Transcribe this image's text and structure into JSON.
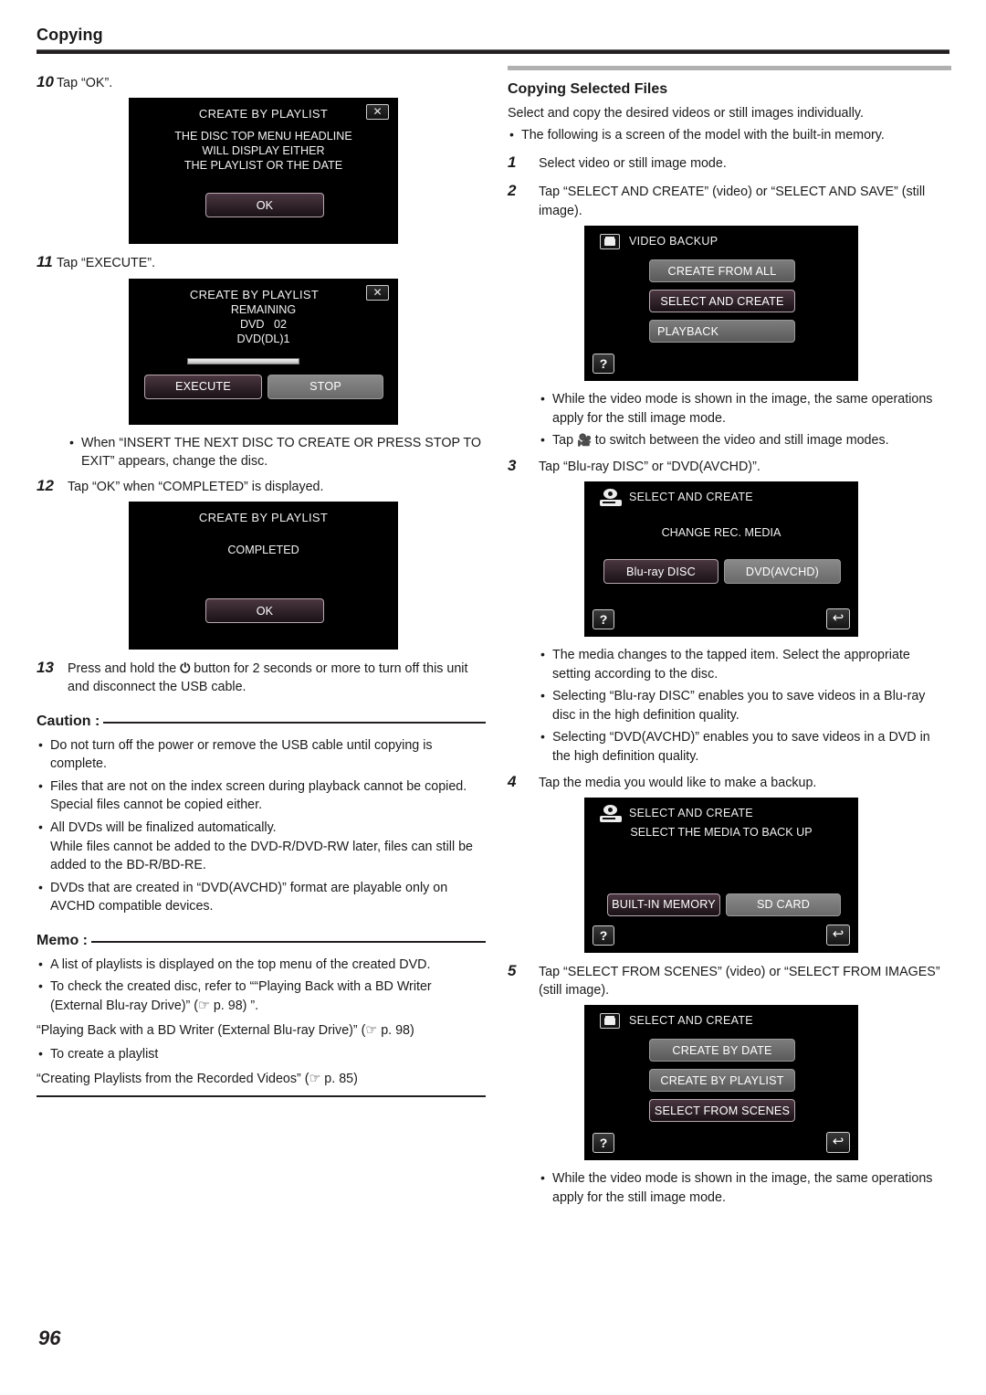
{
  "header": {
    "title": "Copying"
  },
  "page_number": "96",
  "left_column": {
    "step10": {
      "num": "10",
      "text": "Tap “OK”."
    },
    "shot_playlist_notice": {
      "name": "create-by-playlist-notice",
      "title": "CREATE BY PLAYLIST",
      "close_label": "✕",
      "message_lines": [
        "THE DISC TOP MENU HEADLINE",
        "WILL DISPLAY EITHER",
        "THE PLAYLIST OR THE DATE"
      ],
      "ok_label": "OK"
    },
    "step11": {
      "num": "11",
      "text": "Tap “EXECUTE”."
    },
    "shot_remaining": {
      "name": "create-by-playlist-remaining",
      "title": "CREATE BY PLAYLIST",
      "close_label": "✕",
      "message_lines": [
        "REMAINING",
        "DVD   02",
        "DVD(DL)1"
      ],
      "execute_label": "EXECUTE",
      "stop_label": "STOP"
    },
    "note_insert_disc": "When “INSERT THE NEXT DISC TO CREATE OR PRESS STOP TO EXIT” appears, change the disc.",
    "step12": {
      "num": "12",
      "text": "Tap “OK” when “COMPLETED” is displayed."
    },
    "shot_completed": {
      "name": "create-by-playlist-completed",
      "title": "CREATE BY PLAYLIST",
      "message_lines": [
        "COMPLETED"
      ],
      "ok_label": "OK"
    },
    "step13": {
      "num": "13",
      "text_before": "Press and hold the",
      "power_glyph": "⏻",
      "text_after": "button for 2 seconds or more to turn off this unit and disconnect the USB cable."
    },
    "caution": {
      "label": "Caution :",
      "items": [
        "Do not turn off the power or remove the USB cable until copying is complete.",
        "Files that are not on the index screen during playback cannot be copied. Special files cannot be copied either.",
        "All DVDs will be finalized automatically.\nWhile files cannot be added to the DVD-R/DVD-RW later, files can still be added to the BD-R/BD-RE.",
        "DVDs that are created in “DVD(AVCHD)” format are playable only on AVCHD compatible devices."
      ]
    },
    "memo": {
      "label": "Memo :",
      "items": [
        "A list of playlists is displayed on the top menu of the created DVD.",
        "To check the created disc, refer to ““Playing Back with a BD Writer (External Blu-ray Drive)” (☞ p. 98) ”."
      ],
      "ref1": "“Playing Back with a BD Writer (External Blu-ray Drive)” (☞ p. 98)",
      "item2": "To create a playlist",
      "ref2": "“Creating Playlists from the Recorded Videos” (☞ p. 85)"
    }
  },
  "right_column": {
    "section_title": "Copying Selected Files",
    "intro": "Select and copy the desired videos or still images individually.",
    "intro_bullet": "The following is a screen of the model with the built-in memory.",
    "step1": {
      "num": "1",
      "text": "Select video or still image mode."
    },
    "step2": {
      "num": "2",
      "text": "Tap “SELECT AND CREATE” (video) or “SELECT AND SAVE” (still image)."
    },
    "shot_video_backup": {
      "name": "video-backup-menu",
      "icon": "video-camera-icon",
      "title": "VIDEO BACKUP",
      "buttons": [
        "CREATE FROM ALL",
        "SELECT AND CREATE",
        "PLAYBACK"
      ],
      "highlighted_index": 1,
      "help_label": "?"
    },
    "notes_after_video_backup": {
      "bullet1": "While the video mode is shown in the image, the same operations apply for the still image mode.",
      "bullet2_before": "Tap",
      "bullet2_glyph": "🎥",
      "bullet2_after": "to switch between the video and still image modes."
    },
    "step3": {
      "num": "3",
      "text": "Tap “Blu-ray DISC” or “DVD(AVCHD)”."
    },
    "shot_change_media": {
      "name": "select-and-create-change-rec-media",
      "icon": "disc-icon",
      "title": "SELECT AND CREATE",
      "subtitle": "CHANGE REC. MEDIA",
      "buttons": [
        "Blu-ray DISC",
        "DVD(AVCHD)"
      ],
      "highlighted_index": 0,
      "help_label": "?",
      "back_label": "↩"
    },
    "notes_after_change_media": [
      "The media changes to the tapped item. Select the appropriate setting according to the disc.",
      "Selecting “Blu-ray DISC” enables you to save videos in a Blu-ray disc in the high definition quality.",
      "Selecting “DVD(AVCHD)” enables you to save videos in a DVD in the high definition quality."
    ],
    "step4": {
      "num": "4",
      "text": "Tap the media you would like to make a backup."
    },
    "shot_select_media": {
      "name": "select-and-create-select-media",
      "icon": "disc-icon",
      "title": "SELECT AND CREATE",
      "subtitle": "SELECT THE MEDIA TO BACK UP",
      "buttons": [
        "BUILT-IN MEMORY",
        "SD CARD"
      ],
      "highlighted_index": 0,
      "help_label": "?",
      "back_label": "↩"
    },
    "step5": {
      "num": "5",
      "text": "Tap “SELECT FROM SCENES” (video) or “SELECT FROM IMAGES” (still image)."
    },
    "shot_select_and_create": {
      "name": "select-and-create-menu",
      "icon": "video-camera-icon",
      "title": "SELECT AND CREATE",
      "buttons": [
        "CREATE BY DATE",
        "CREATE BY PLAYLIST",
        "SELECT FROM SCENES"
      ],
      "highlighted_index": 2,
      "help_label": "?",
      "back_label": "↩"
    },
    "final_note": "While the video mode is shown in the image, the same operations apply for the still image mode."
  }
}
